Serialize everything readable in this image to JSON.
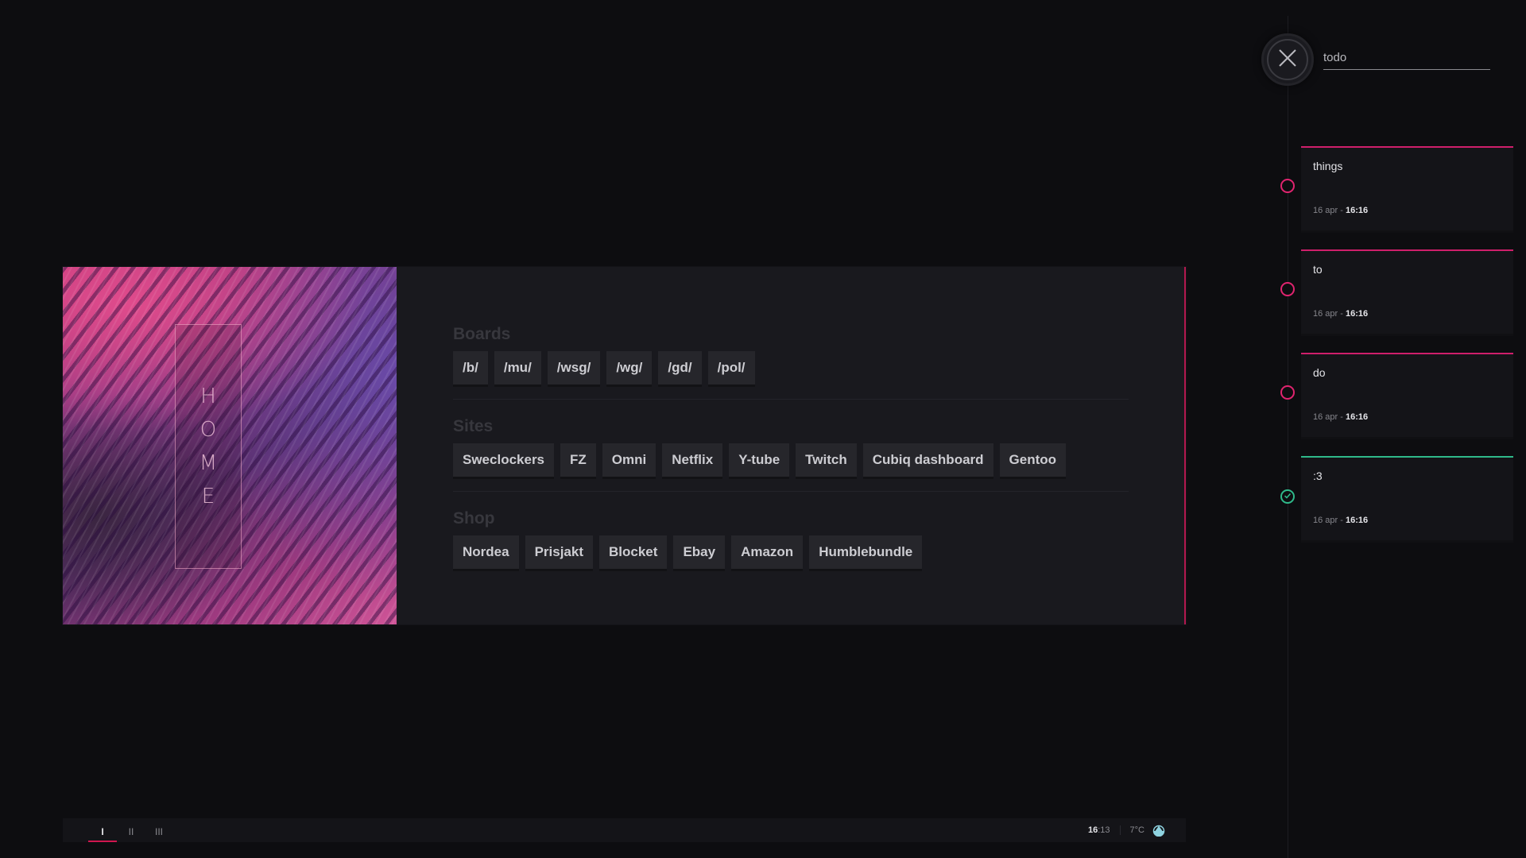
{
  "banner": {
    "letters": [
      "H",
      "O",
      "M",
      "E"
    ]
  },
  "sections": [
    {
      "title": "Boards",
      "links": [
        "/b/",
        "/mu/",
        "/wsg/",
        "/wg/",
        "/gd/",
        "/pol/"
      ]
    },
    {
      "title": "Sites",
      "links": [
        "Sweclockers",
        "FZ",
        "Omni",
        "Netflix",
        "Y-tube",
        "Twitch",
        "Cubiq dashboard",
        "Gentoo"
      ]
    },
    {
      "title": "Shop",
      "links": [
        "Nordea",
        "Prisjakt",
        "Blocket",
        "Ebay",
        "Amazon",
        "Humblebundle"
      ]
    }
  ],
  "statusbar": {
    "tabs": [
      "I",
      "II",
      "III"
    ],
    "active_tab": 0,
    "clock_hour": "16",
    "clock_minute": ":13",
    "temperature": "7°C",
    "weather_icon": "water-drop-icon"
  },
  "todo": {
    "input_placeholder": "todo",
    "close_icon": "close-icon",
    "items": [
      {
        "text": "things",
        "date": "16 apr - ",
        "time": "16:16",
        "done": false
      },
      {
        "text": "to",
        "date": "16 apr - ",
        "time": "16:16",
        "done": false
      },
      {
        "text": "do",
        "date": "16 apr - ",
        "time": "16:16",
        "done": false
      },
      {
        "text": ":3",
        "date": "16 apr - ",
        "time": "16:16",
        "done": true
      }
    ]
  },
  "colors": {
    "background": "#0d0d10",
    "accent_pink": "#e0246f",
    "done_green": "#2fb98a",
    "card": "#19191e"
  }
}
